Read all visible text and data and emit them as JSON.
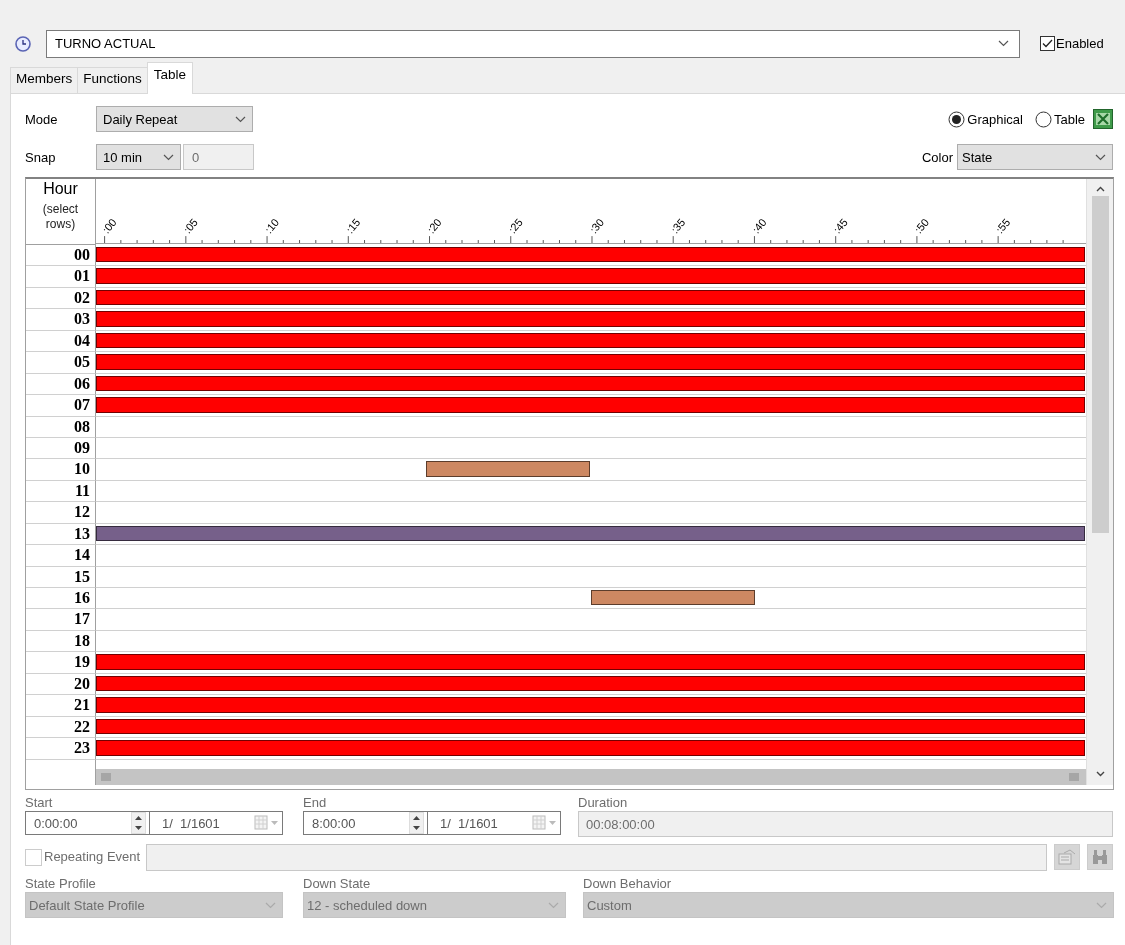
{
  "schedule_selector": {
    "value": "TURNO ACTUAL"
  },
  "enabled": {
    "label": "Enabled",
    "checked": true
  },
  "tabs": [
    {
      "label": "Members",
      "selected": false
    },
    {
      "label": "Functions",
      "selected": false
    },
    {
      "label": "Table",
      "selected": true
    }
  ],
  "mode": {
    "label": "Mode",
    "value": "Daily Repeat"
  },
  "snap": {
    "label": "Snap",
    "value": "10 min",
    "custom_value": "0"
  },
  "view_options": [
    {
      "label": "Graphical",
      "selected": true
    },
    {
      "label": "Table",
      "selected": false
    }
  ],
  "color_by": {
    "label": "Color",
    "value": "State"
  },
  "timeline": {
    "hour_header": "Hour",
    "hour_hint": "(select rows)",
    "tick_labels": [
      ":00",
      ":05",
      ":10",
      ":15",
      ":20",
      ":25",
      ":30",
      ":35",
      ":40",
      ":45",
      ":50",
      ":55"
    ],
    "rows": [
      {
        "hour": "00",
        "slots": [
          {
            "scheduled": true,
            "color": "#ff0000"
          },
          {
            "scheduled": true,
            "color": "#ff0000"
          },
          {
            "scheduled": true,
            "color": "#ff0000"
          },
          {
            "scheduled": true,
            "color": "#ff0000"
          },
          {
            "scheduled": true,
            "color": "#ff0000"
          },
          {
            "scheduled": true,
            "color": "#ff0000"
          }
        ]
      },
      {
        "hour": "01",
        "slots": [
          {
            "scheduled": true,
            "color": "#ff0000"
          },
          {
            "scheduled": true,
            "color": "#ff0000"
          },
          {
            "scheduled": true,
            "color": "#ff0000"
          },
          {
            "scheduled": true,
            "color": "#ff0000"
          },
          {
            "scheduled": true,
            "color": "#ff0000"
          },
          {
            "scheduled": true,
            "color": "#ff0000"
          }
        ]
      },
      {
        "hour": "02",
        "slots": [
          {
            "scheduled": true,
            "color": "#ff0000"
          },
          {
            "scheduled": true,
            "color": "#ff0000"
          },
          {
            "scheduled": true,
            "color": "#ff0000"
          },
          {
            "scheduled": true,
            "color": "#ff0000"
          },
          {
            "scheduled": true,
            "color": "#ff0000"
          },
          {
            "scheduled": true,
            "color": "#ff0000"
          }
        ]
      },
      {
        "hour": "03",
        "slots": [
          {
            "scheduled": true,
            "color": "#ff0000"
          },
          {
            "scheduled": true,
            "color": "#ff0000"
          },
          {
            "scheduled": true,
            "color": "#ff0000"
          },
          {
            "scheduled": true,
            "color": "#ff0000"
          },
          {
            "scheduled": true,
            "color": "#ff0000"
          },
          {
            "scheduled": true,
            "color": "#ff0000"
          }
        ]
      },
      {
        "hour": "04",
        "slots": [
          {
            "scheduled": true,
            "color": "#ff0000"
          },
          {
            "scheduled": true,
            "color": "#ff0000"
          },
          {
            "scheduled": true,
            "color": "#ff0000"
          },
          {
            "scheduled": true,
            "color": "#ff0000"
          },
          {
            "scheduled": true,
            "color": "#ff0000"
          },
          {
            "scheduled": true,
            "color": "#ff0000"
          }
        ]
      },
      {
        "hour": "05",
        "slots": [
          {
            "scheduled": true,
            "color": "#ff0000"
          },
          {
            "scheduled": true,
            "color": "#ff0000"
          },
          {
            "scheduled": true,
            "color": "#ff0000"
          },
          {
            "scheduled": true,
            "color": "#ff0000"
          },
          {
            "scheduled": true,
            "color": "#ff0000"
          },
          {
            "scheduled": true,
            "color": "#ff0000"
          }
        ]
      },
      {
        "hour": "06",
        "slots": [
          {
            "scheduled": true,
            "color": "#ff0000"
          },
          {
            "scheduled": true,
            "color": "#ff0000"
          },
          {
            "scheduled": true,
            "color": "#ff0000"
          },
          {
            "scheduled": true,
            "color": "#ff0000"
          },
          {
            "scheduled": true,
            "color": "#ff0000"
          },
          {
            "scheduled": true,
            "color": "#ff0000"
          }
        ]
      },
      {
        "hour": "07",
        "slots": [
          {
            "scheduled": true,
            "color": "#ff0000"
          },
          {
            "scheduled": true,
            "color": "#ff0000"
          },
          {
            "scheduled": true,
            "color": "#ff0000"
          },
          {
            "scheduled": true,
            "color": "#ff0000"
          },
          {
            "scheduled": true,
            "color": "#ff0000"
          },
          {
            "scheduled": true,
            "color": "#ff0000"
          }
        ]
      },
      {
        "hour": "08",
        "slots": [
          {
            "scheduled": false
          },
          {
            "scheduled": false
          },
          {
            "scheduled": false
          },
          {
            "scheduled": false
          },
          {
            "scheduled": false
          },
          {
            "scheduled": false
          }
        ]
      },
      {
        "hour": "09",
        "slots": [
          {
            "scheduled": false
          },
          {
            "scheduled": false
          },
          {
            "scheduled": false
          },
          {
            "scheduled": false
          },
          {
            "scheduled": false
          },
          {
            "scheduled": false
          }
        ]
      },
      {
        "hour": "10",
        "slots": [
          {
            "scheduled": false
          },
          {
            "scheduled": false
          },
          {
            "scheduled": true,
            "color": "#cd8862"
          },
          {
            "scheduled": false
          },
          {
            "scheduled": false
          },
          {
            "scheduled": false
          }
        ]
      },
      {
        "hour": "11",
        "slots": [
          {
            "scheduled": false
          },
          {
            "scheduled": false
          },
          {
            "scheduled": false
          },
          {
            "scheduled": false
          },
          {
            "scheduled": false
          },
          {
            "scheduled": false
          }
        ]
      },
      {
        "hour": "12",
        "slots": [
          {
            "scheduled": false
          },
          {
            "scheduled": false
          },
          {
            "scheduled": false
          },
          {
            "scheduled": false
          },
          {
            "scheduled": false
          },
          {
            "scheduled": false
          }
        ]
      },
      {
        "hour": "13",
        "slots": [
          {
            "scheduled": true,
            "color": "#76608a"
          },
          {
            "scheduled": true,
            "color": "#76608a"
          },
          {
            "scheduled": true,
            "color": "#76608a"
          },
          {
            "scheduled": true,
            "color": "#76608a"
          },
          {
            "scheduled": true,
            "color": "#76608a"
          },
          {
            "scheduled": true,
            "color": "#76608a"
          }
        ]
      },
      {
        "hour": "14",
        "slots": [
          {
            "scheduled": false
          },
          {
            "scheduled": false
          },
          {
            "scheduled": false
          },
          {
            "scheduled": false
          },
          {
            "scheduled": false
          },
          {
            "scheduled": false
          }
        ]
      },
      {
        "hour": "15",
        "slots": [
          {
            "scheduled": false
          },
          {
            "scheduled": false
          },
          {
            "scheduled": false
          },
          {
            "scheduled": false
          },
          {
            "scheduled": false
          },
          {
            "scheduled": false
          }
        ]
      },
      {
        "hour": "16",
        "slots": [
          {
            "scheduled": false
          },
          {
            "scheduled": false
          },
          {
            "scheduled": false
          },
          {
            "scheduled": true,
            "color": "#cd8862"
          },
          {
            "scheduled": false
          },
          {
            "scheduled": false
          }
        ]
      },
      {
        "hour": "17",
        "slots": [
          {
            "scheduled": false
          },
          {
            "scheduled": false
          },
          {
            "scheduled": false
          },
          {
            "scheduled": false
          },
          {
            "scheduled": false
          },
          {
            "scheduled": false
          }
        ]
      },
      {
        "hour": "18",
        "slots": [
          {
            "scheduled": false
          },
          {
            "scheduled": false
          },
          {
            "scheduled": false
          },
          {
            "scheduled": false
          },
          {
            "scheduled": false
          },
          {
            "scheduled": false
          }
        ]
      },
      {
        "hour": "19",
        "slots": [
          {
            "scheduled": true,
            "color": "#ff0000"
          },
          {
            "scheduled": true,
            "color": "#ff0000"
          },
          {
            "scheduled": true,
            "color": "#ff0000"
          },
          {
            "scheduled": true,
            "color": "#ff0000"
          },
          {
            "scheduled": true,
            "color": "#ff0000"
          },
          {
            "scheduled": true,
            "color": "#ff0000"
          }
        ]
      },
      {
        "hour": "20",
        "slots": [
          {
            "scheduled": true,
            "color": "#ff0000"
          },
          {
            "scheduled": true,
            "color": "#ff0000"
          },
          {
            "scheduled": true,
            "color": "#ff0000"
          },
          {
            "scheduled": true,
            "color": "#ff0000"
          },
          {
            "scheduled": true,
            "color": "#ff0000"
          },
          {
            "scheduled": true,
            "color": "#ff0000"
          }
        ]
      },
      {
        "hour": "21",
        "slots": [
          {
            "scheduled": true,
            "color": "#ff0000"
          },
          {
            "scheduled": true,
            "color": "#ff0000"
          },
          {
            "scheduled": true,
            "color": "#ff0000"
          },
          {
            "scheduled": true,
            "color": "#ff0000"
          },
          {
            "scheduled": true,
            "color": "#ff0000"
          },
          {
            "scheduled": true,
            "color": "#ff0000"
          }
        ]
      },
      {
        "hour": "22",
        "slots": [
          {
            "scheduled": true,
            "color": "#ff0000"
          },
          {
            "scheduled": true,
            "color": "#ff0000"
          },
          {
            "scheduled": true,
            "color": "#ff0000"
          },
          {
            "scheduled": true,
            "color": "#ff0000"
          },
          {
            "scheduled": true,
            "color": "#ff0000"
          },
          {
            "scheduled": true,
            "color": "#ff0000"
          }
        ]
      },
      {
        "hour": "23",
        "slots": [
          {
            "scheduled": true,
            "color": "#ff0000"
          },
          {
            "scheduled": true,
            "color": "#ff0000"
          },
          {
            "scheduled": true,
            "color": "#ff0000"
          },
          {
            "scheduled": true,
            "color": "#ff0000"
          },
          {
            "scheduled": true,
            "color": "#ff0000"
          },
          {
            "scheduled": true,
            "color": "#ff0000"
          }
        ]
      }
    ]
  },
  "start": {
    "label": "Start",
    "time": "0:00:00",
    "date": "1/  1/1601"
  },
  "end": {
    "label": "End",
    "time": "8:00:00",
    "date": "1/  1/1601"
  },
  "duration": {
    "label": "Duration",
    "value": "00:08:00:00"
  },
  "repeating_event": {
    "label": "Repeating Event",
    "checked": false
  },
  "state_profile": {
    "label": "State Profile",
    "value": "Default State Profile",
    "disabled": true
  },
  "down_state": {
    "label": "Down State",
    "value": "12 - scheduled down",
    "disabled": true
  },
  "down_behavior": {
    "label": "Down Behavior",
    "value": "Custom",
    "disabled": true
  }
}
